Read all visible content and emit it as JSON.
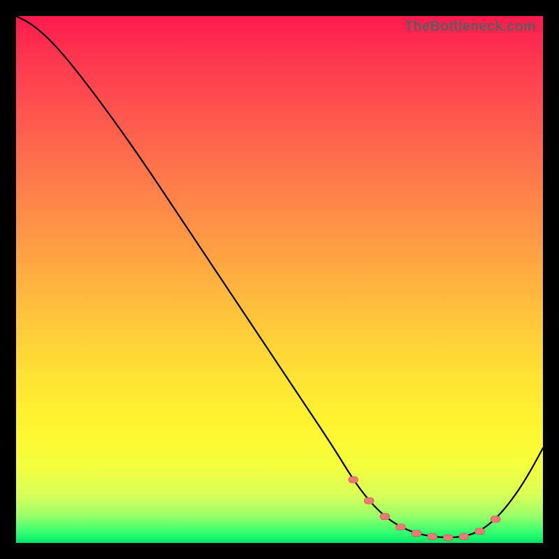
{
  "watermark": "TheBottleneck.com",
  "colors": {
    "frame": "#000000",
    "curve_stroke": "#000000",
    "marker_fill": "#e97a74",
    "marker_stroke": "#c2534e"
  },
  "chart_data": {
    "type": "line",
    "title": "",
    "xlabel": "",
    "ylabel": "",
    "xlim": [
      0,
      100
    ],
    "ylim": [
      0,
      100
    ],
    "grid": false,
    "legend": false,
    "x": [
      0,
      3,
      7,
      12,
      18,
      24,
      30,
      36,
      42,
      48,
      54,
      60,
      64,
      67,
      70,
      73,
      76,
      79,
      82,
      85,
      88,
      91,
      94,
      97,
      100
    ],
    "values": [
      100,
      98.5,
      95,
      89,
      81,
      72.5,
      63.5,
      54.5,
      45.5,
      36.5,
      27.5,
      18.5,
      12,
      8,
      5,
      3,
      1.8,
      1.2,
      1.0,
      1.2,
      2.2,
      4.5,
      8,
      12.5,
      18
    ],
    "markers": {
      "x": [
        64,
        67,
        70,
        73,
        76,
        79,
        82,
        85,
        88,
        91
      ],
      "y": [
        12,
        8,
        5,
        3,
        1.8,
        1.2,
        1.0,
        1.2,
        2.2,
        4.5
      ]
    }
  }
}
